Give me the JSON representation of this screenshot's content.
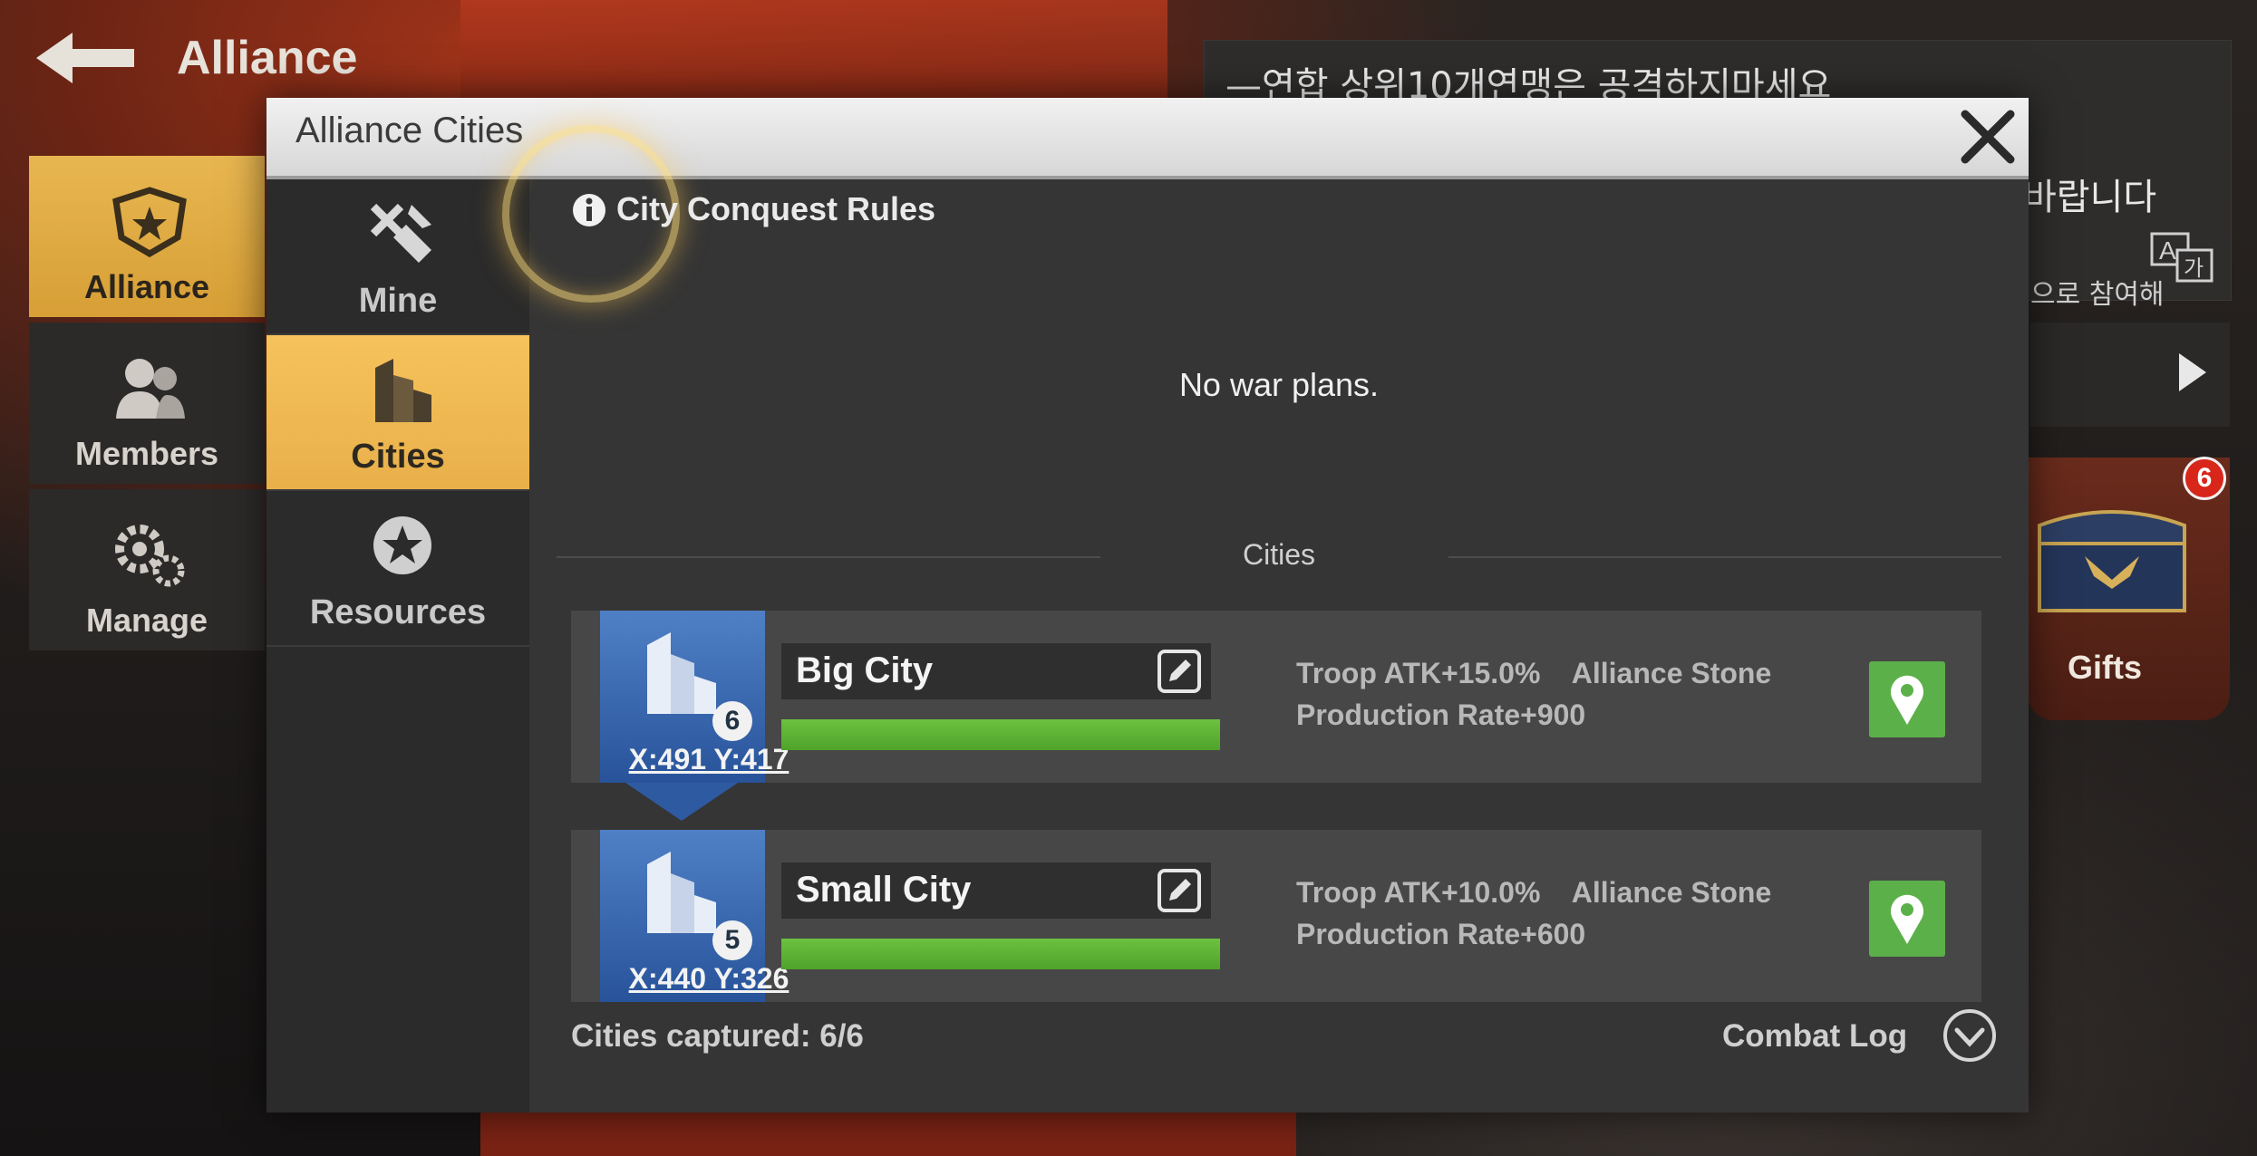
{
  "screen": {
    "title": "Alliance"
  },
  "left_nav": [
    {
      "label": "Alliance",
      "icon": "alliance-emblem-icon"
    },
    {
      "label": "Members",
      "icon": "members-icon"
    },
    {
      "label": "Manage",
      "icon": "gears-icon"
    }
  ],
  "notice": {
    "line1": "—연합 상위10개연맹은 공격하지마세요",
    "line2": "바랍니다",
    "line3": "으로 참여해"
  },
  "gifts": {
    "label": "Gifts",
    "badge": "6"
  },
  "modal": {
    "title": "Alliance Cities",
    "rules_link": "City Conquest Rules",
    "empty_message": "No war plans.",
    "section_label": "Cities",
    "tabs": [
      {
        "label": "Mine",
        "icon": "mine-tools-icon"
      },
      {
        "label": "Cities",
        "icon": "city-buildings-icon"
      },
      {
        "label": "Resources",
        "icon": "resource-coin-icon"
      }
    ],
    "active_tab": "Cities",
    "cities": [
      {
        "name": "Big City",
        "level": "6",
        "coords": "X:491 Y:417",
        "buff_line1": "Troop ATK+15.0%    Alliance Stone",
        "buff_line2": "Production Rate+900",
        "bar_fraction": 1.0
      },
      {
        "name": "Small City",
        "level": "5",
        "coords": "X:440 Y:326",
        "buff_line1": "Troop ATK+10.0%    Alliance Stone",
        "buff_line2": "Production Rate+600",
        "bar_fraction": 1.0
      }
    ],
    "captured_text": "Cities captured: 6/6",
    "combat_log_label": "Combat Log"
  },
  "colors": {
    "accent_yellow": "#e9b04a",
    "bar_green": "#5cb530",
    "location_green": "#5cb04a",
    "city_blue": "#3c6bb3"
  }
}
